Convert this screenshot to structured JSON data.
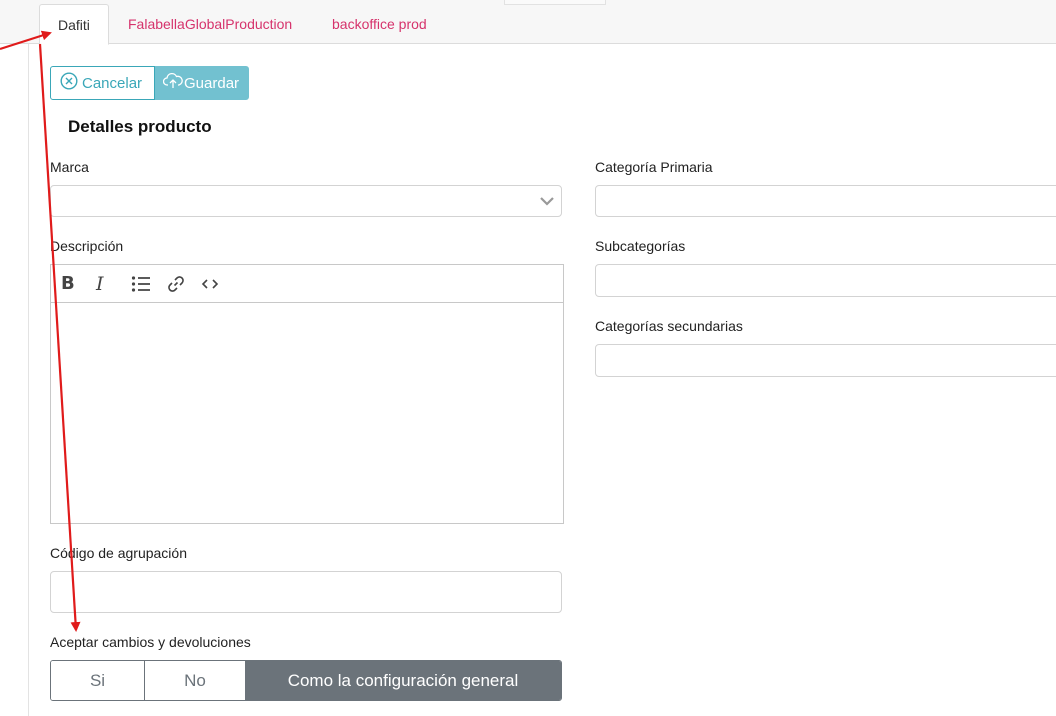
{
  "tabs": [
    {
      "label": "Dafiti",
      "active": true
    },
    {
      "label": "FalabellaGlobalProduction",
      "active": false
    },
    {
      "label": "backoffice prod",
      "active": false
    }
  ],
  "actions": {
    "cancel_label": "Cancelar",
    "save_label": "Guardar"
  },
  "section": {
    "title": "Detalles producto"
  },
  "form": {
    "marca_label": "Marca",
    "marca_value": "",
    "descripcion_label": "Descripción",
    "codigo_label": "Código de agrupación",
    "codigo_value": "",
    "aceptar_label": "Aceptar cambios y devoluciones",
    "aceptar_options": [
      "Si",
      "No",
      "Como la configuración general"
    ],
    "aceptar_selected": "Como la configuración general",
    "categoria_primaria_label": "Categoría Primaria",
    "subcategorias_label": "Subcategorías",
    "categorias_secundarias_label": "Categorías secundarias"
  },
  "editor_toolbar": [
    "bold-icon",
    "italic-icon",
    "bulleted-list-icon",
    "link-icon",
    "code-icon"
  ],
  "colors": {
    "accent": "#3aa7b8",
    "accent_light": "#72c1d0",
    "tab_link": "#d6336c",
    "segment_active": "#6b737a",
    "annotation": "#e01b1b"
  }
}
